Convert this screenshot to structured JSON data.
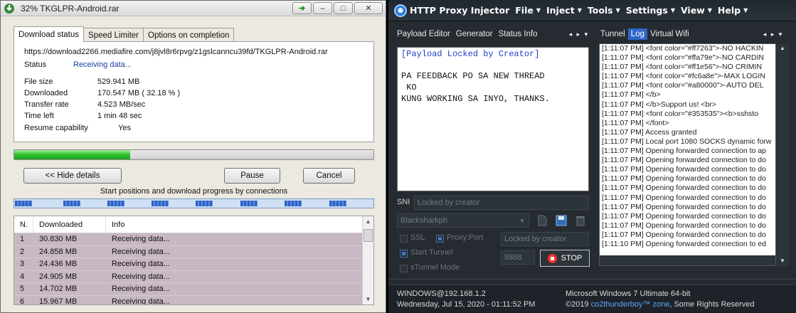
{
  "idm": {
    "title": "32% TKGLPR-Android.rar",
    "tabs": [
      "Download status",
      "Speed Limiter",
      "Options on completion"
    ],
    "url": "https://download2266.mediafire.com/j8jvl8r6rpvg/z1gslcanncu39fd/TKGLPR-Android.rar",
    "status_label": "Status",
    "status_value": "Receiving data...",
    "file_size_label": "File size",
    "file_size_value": "529.941  MB",
    "downloaded_label": "Downloaded",
    "downloaded_value": "170.547  MB  ( 32.18 % )",
    "transfer_rate_label": "Transfer rate",
    "transfer_rate_value": "4.523  MB/sec",
    "time_left_label": "Time left",
    "time_left_value": "1 min 48 sec",
    "resume_label": "Resume capability",
    "resume_value": "Yes",
    "progress_percent": 32.18,
    "hide_details_label": "<< Hide details",
    "pause_label": "Pause",
    "cancel_label": "Cancel",
    "connections_caption": "Start positions and download progress by connections",
    "columns": [
      "N.",
      "Downloaded",
      "Info"
    ],
    "rows": [
      {
        "n": "1",
        "downloaded": "30.830  MB",
        "info": "Receiving data..."
      },
      {
        "n": "2",
        "downloaded": "24.858  MB",
        "info": "Receiving data..."
      },
      {
        "n": "3",
        "downloaded": "24.436  MB",
        "info": "Receiving data..."
      },
      {
        "n": "4",
        "downloaded": "24.905  MB",
        "info": "Receiving data..."
      },
      {
        "n": "5",
        "downloaded": "14.702  MB",
        "info": "Receiving data..."
      },
      {
        "n": "6",
        "downloaded": "15.967  MB",
        "info": "Receiving data..."
      }
    ]
  },
  "hpi": {
    "title": "HTTP Proxy Injector",
    "menus": [
      "File",
      "Inject",
      "Tools",
      "Settings",
      "View",
      "Help"
    ],
    "left_tabs": [
      "Payload Editor",
      "Generator",
      "Status Info"
    ],
    "right_tabs": [
      "Tunnel",
      "Log",
      "Virtual Wifi"
    ],
    "payload_locked": "[Payload Locked by Creator]",
    "payload_lines": [
      "PA FEEDBACK PO SA NEW THREAD",
      " KO",
      "KUNG WORKING SA INYO, THANKS."
    ],
    "sni_label": "SNI",
    "sni_placeholder": "Locked by creator",
    "server_select": "Blacksharkph",
    "ssl_label": "SSL",
    "proxy_port_label": "Proxy:Port",
    "proxy_value": "Locked by creator",
    "start_tunnel_label": "Start Tunnel",
    "stunnel_label": "sTunnel Mode",
    "port_value": "8888",
    "stop_label": "STOP",
    "log_lines": [
      "[1:11:07 PM] <font color=\"#ff7263\">-NO HACKIN",
      "[1:11:07 PM] <font color=\"#ffa79e\">-NO CARDIN",
      "[1:11:07 PM] <font color=\"#ff1e56\">-NO CRIMIN",
      "[1:11:07 PM] <font color=\"#fc6a8e\">-MAX LOGIN",
      "[1:11:07 PM] <font color=\"#a80000\">-AUTO DEL",
      "[1:11:07 PM] </b>",
      "[1:11:07 PM] </b>Support us! <br>",
      "[1:11:07 PM] <font color=\"#353535\"><b>sshsto",
      "[1:11:07 PM] </font>",
      "[1:11:07 PM] Access granted",
      "[1:11:07 PM] Local port 1080 SOCKS dynamic forw",
      "[1:11:07 PM] Opening forwarded connection to ap",
      "[1:11:07 PM] Opening forwarded connection to do",
      "[1:11:07 PM] Opening forwarded connection to do",
      "[1:11:07 PM] Opening forwarded connection to do",
      "[1:11:07 PM] Opening forwarded connection to do",
      "[1:11:07 PM] Opening forwarded connection to do",
      "[1:11:07 PM] Opening forwarded connection to do",
      "[1:11:07 PM] Opening forwarded connection to do",
      "[1:11:07 PM] Opening forwarded connection to do",
      "[1:11:07 PM] Opening forwarded connection to do",
      "[1:11:10 PM] Opening forwarded connection to ed"
    ],
    "footer_left_1": "WINDOWS@192.168.1.2",
    "footer_left_2": "Wednesday, Jul 15, 2020 - 01:11:52 PM",
    "footer_right_1": "Microsoft Windows 7 Ultimate  64-bit",
    "footer_right_2_prefix": "©2019",
    "footer_right_2_link": "co2thunderboy™ zone",
    "footer_right_2_suffix": ", Some Rights Reserved"
  }
}
